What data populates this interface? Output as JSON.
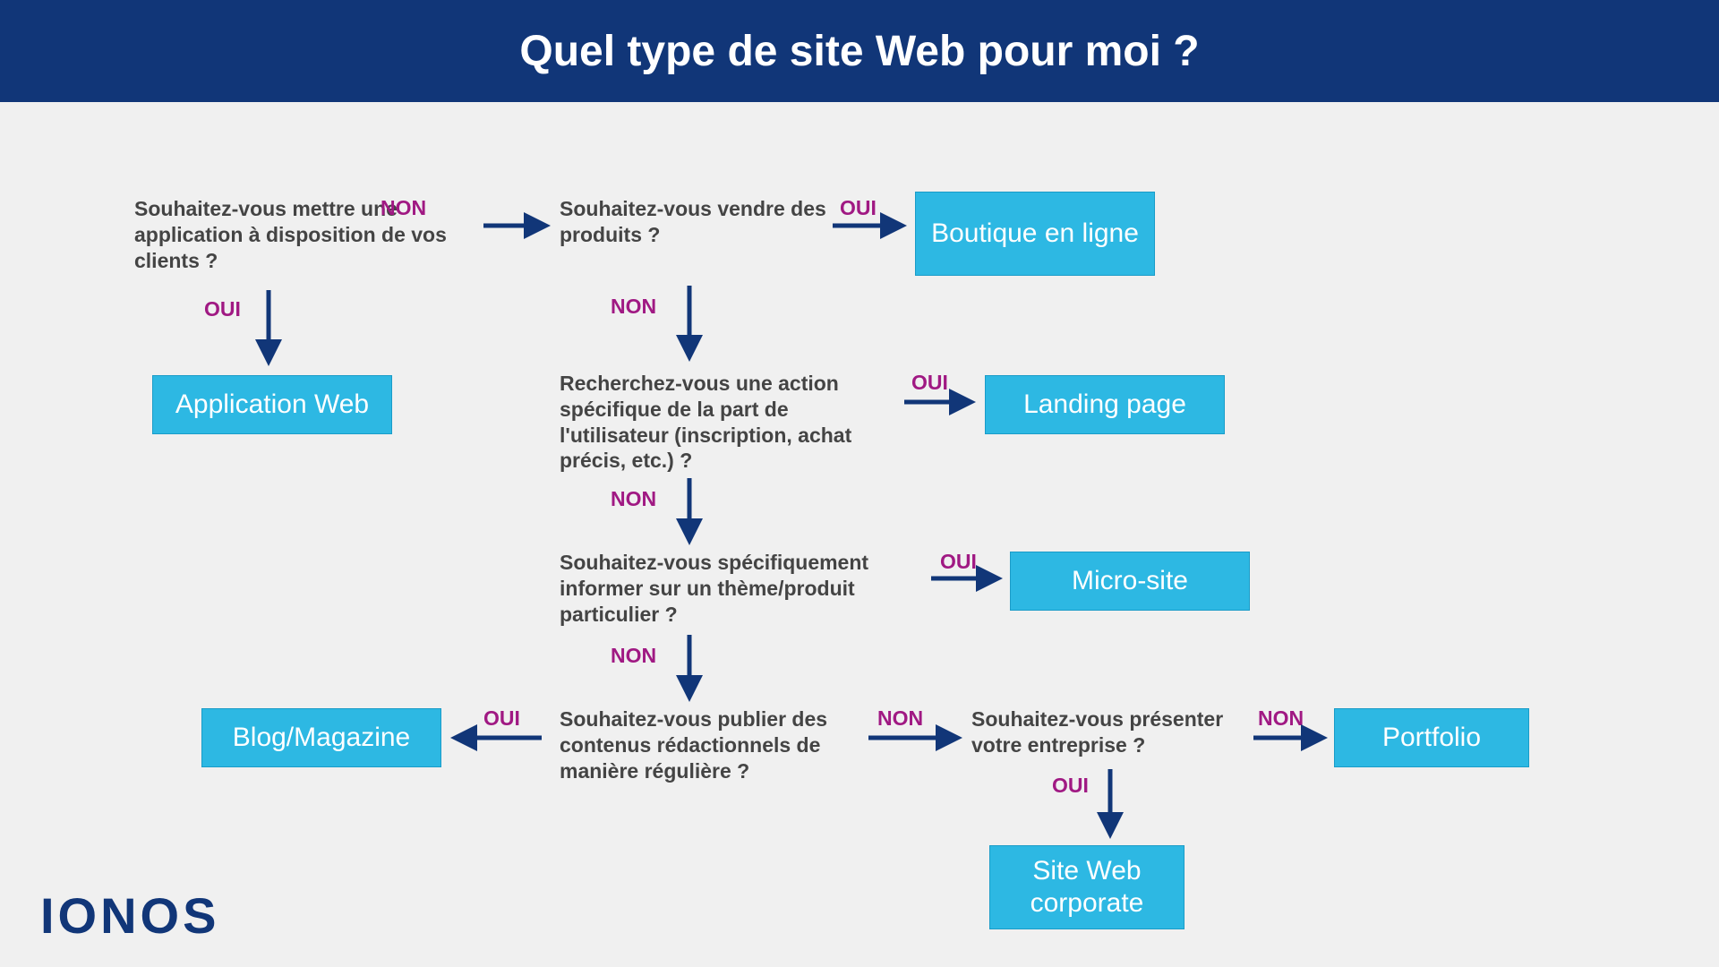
{
  "header": {
    "title": "Quel type de site Web pour moi ?"
  },
  "brand": "IONOS",
  "labels": {
    "yes": "OUI",
    "no": "NON"
  },
  "questions": {
    "q1": "Souhaitez-vous mettre une application à disposition de vos clients ?",
    "q2": "Souhaitez-vous vendre des produits ?",
    "q3": "Recherchez-vous une action spécifique de la part de l'utilisateur (inscription, achat précis, etc.) ?",
    "q4": "Souhaitez-vous spécifiquement informer sur un thème/produit particulier ?",
    "q5": "Souhaitez-vous publier des contenus rédactionnels de manière régulière ?",
    "q6": "Souhaitez-vous présenter votre entreprise ?"
  },
  "results": {
    "r1": "Application Web",
    "r2": "Boutique en ligne",
    "r3": "Landing page",
    "r4": "Micro-site",
    "r5": "Blog/Magazine",
    "r6": "Site Web corporate",
    "r7": "Portfolio"
  }
}
